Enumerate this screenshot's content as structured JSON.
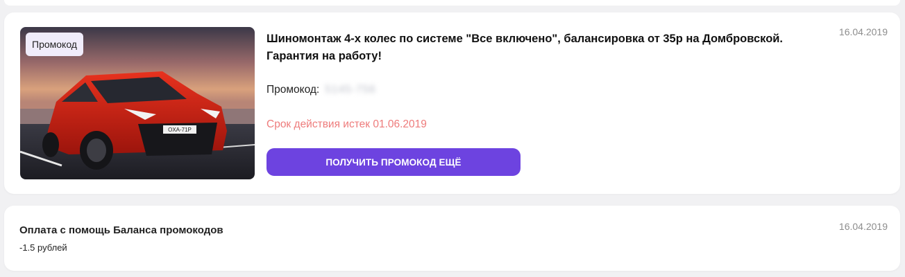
{
  "promo_card": {
    "badge": "Промокод",
    "title": "Шиномонтаж 4-х колес по системе \"Все включено\", балансировка от 35р на Домбровской. Гарантия на работу!",
    "code_label": "Промокод:",
    "code_value": "5145-756",
    "expired_text": "Срок действия истек 01.06.2019",
    "button_label": "ПОЛУЧИТЬ ПРОМОКОД ЕЩЁ",
    "date": "16.04.2019",
    "plate": "OXA-71P"
  },
  "payment_card": {
    "title": "Оплата с помощь Баланса промокодов",
    "amount": "-1.5 рублей",
    "date": "16.04.2019"
  },
  "colors": {
    "accent": "#6d43e0",
    "expired": "#ee7b7b",
    "badge_bg": "#f0ecfa",
    "date": "#8d8d8d"
  }
}
